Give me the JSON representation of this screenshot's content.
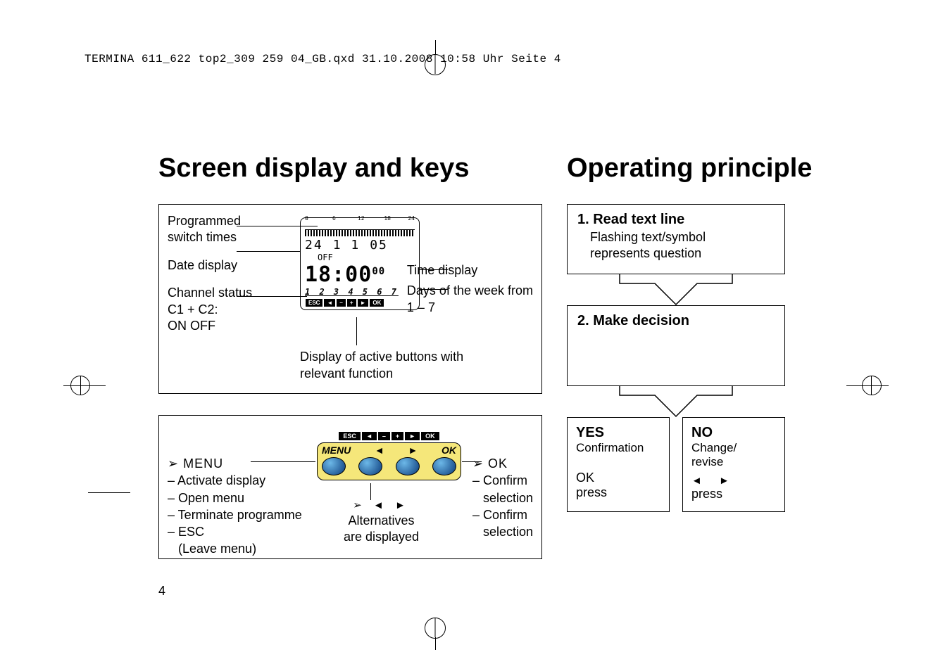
{
  "header_line": "TERMINA 611_622 top2_309 259 04_GB.qxd  31.10.2008  10:58 Uhr  Seite 4",
  "title_left": "Screen display and keys",
  "title_right": "Operating principle",
  "diagA": {
    "left_labels": {
      "programmed": "Programmed\nswitch times",
      "date": "Date display",
      "channel": "Channel status\nC1 + C2:\nON  OFF"
    },
    "right_labels": {
      "time": "Time display",
      "days": "Days of the week from\n1 – 7"
    },
    "lcd": {
      "scale_ticks": [
        "0",
        "6",
        "12",
        "18",
        "24"
      ],
      "date_day": "24",
      "date_mon": "1 1",
      "date_yr": "05",
      "off": "OFF",
      "time_main": "18:00",
      "time_sec": "00",
      "days": "1 2 3 4 5 6 7",
      "btn_row": [
        "ESC",
        "◄",
        "–",
        "+",
        "►",
        "OK"
      ]
    },
    "caption_bottom": "Display of active buttons with\nrelevant function"
  },
  "diagB": {
    "menu_head": "➢ MENU",
    "menu_items": [
      "– Activate display",
      "– Open menu",
      "– Terminate programme",
      "– ESC",
      "   (Leave menu)"
    ],
    "ok_head": "➢ OK",
    "ok_items": [
      "– Confirm",
      "   selection",
      "– Confirm",
      "   selection"
    ],
    "keys_header": [
      "ESC",
      "◄",
      "–",
      "+",
      "►",
      "OK"
    ],
    "keys_labels": {
      "menu": "MENU",
      "left": "◄",
      "right": "►",
      "ok": "OK"
    },
    "alt_arrows": "➢ ◄ ►",
    "alt_line1": "Alternatives",
    "alt_line2": "are displayed"
  },
  "flow": {
    "step1_head": "1. Read text line",
    "step1_body": "Flashing text/symbol\nrepresents question",
    "step2_head": "2. Make decision",
    "yes_head": "YES",
    "yes_sub": "Confirmation",
    "yes_act1": "OK",
    "yes_act2": "press",
    "no_head": "NO",
    "no_sub": "Change/\nrevise",
    "no_arrows": "◄   ►",
    "no_act": "press"
  },
  "page_number": "4"
}
